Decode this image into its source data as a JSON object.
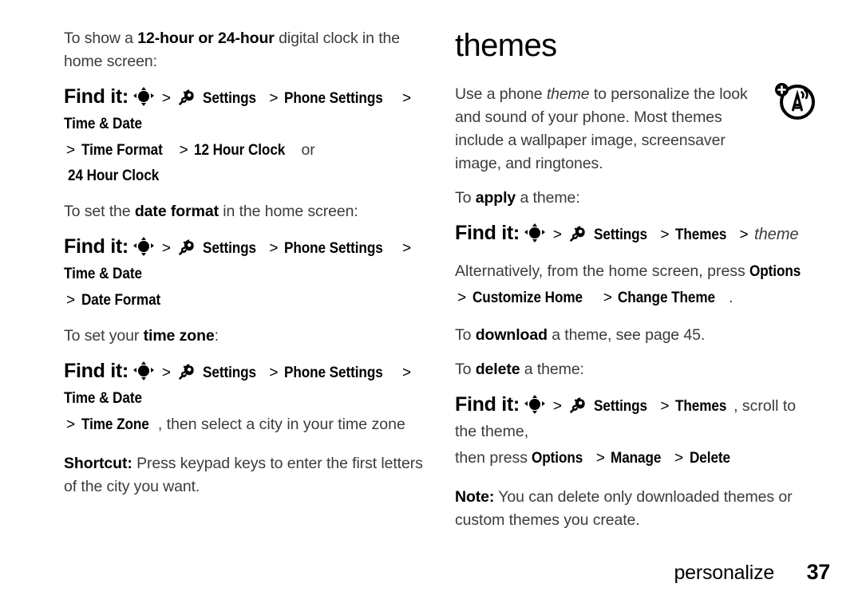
{
  "document": {
    "chapter": "personalize",
    "page_number": "37"
  },
  "left_column": {
    "intro_clock": {
      "prefix": "To show a ",
      "bold": "12-hour or 24-hour",
      "suffix": " digital clock in the home screen:"
    },
    "findit_clock": {
      "label": "Find it:",
      "nav_icon": "navigation-key-icon",
      "settings_icon": "settings-gear-wrench-icon",
      "settings": "Settings",
      "phone_settings": "Phone Settings",
      "time_date": "Time & Date",
      "time_format": "Time Format",
      "clock_12": "12 Hour Clock",
      "or_word": "or",
      "clock_24": "24 Hour Clock",
      "sep": ">"
    },
    "intro_dateformat": {
      "prefix": "To set the ",
      "bold": "date format",
      "suffix": " in the home screen:"
    },
    "findit_dateformat": {
      "label": "Find it:",
      "settings": "Settings",
      "phone_settings": "Phone Settings",
      "time_date": "Time & Date",
      "date_format": "Date Format",
      "sep": ">"
    },
    "intro_timezone": {
      "prefix": "To set your ",
      "bold": "time zone",
      "suffix": ":"
    },
    "findit_timezone": {
      "label": "Find it:",
      "settings": "Settings",
      "phone_settings": "Phone Settings",
      "time_date": "Time & Date",
      "time_zone": "Time Zone",
      "trailing": ", then select a city in your time zone",
      "sep": ">"
    },
    "shortcut": {
      "bold": "Shortcut:",
      "text": " Press keypad keys to enter the first letters of the city you want."
    }
  },
  "right_column": {
    "heading": "themes",
    "corner_icon": "antenna-tower-plus-icon",
    "intro": {
      "part1": "Use a phone ",
      "italic": "theme",
      "part2": " to personalize the look and sound of your phone. Most themes include a wallpaper image, screensaver image, and ringtones."
    },
    "apply_intro": {
      "prefix": "To ",
      "bold": "apply",
      "suffix": " a theme:"
    },
    "findit_apply": {
      "label": "Find it:",
      "settings": "Settings",
      "themes": "Themes",
      "theme_italic": "theme",
      "sep": ">"
    },
    "alternatively": {
      "text": "Alternatively, from the home screen, press ",
      "options": "Options",
      "customize_home": "Customize Home",
      "change_theme": "Change Theme",
      "period": ".",
      "sep": ">"
    },
    "download_note": {
      "prefix": "To ",
      "bold": "download",
      "suffix": " a theme, see page 45."
    },
    "delete_intro": {
      "prefix": "To ",
      "bold": "delete",
      "suffix": " a theme:"
    },
    "findit_delete": {
      "label": "Find it:",
      "settings": "Settings",
      "themes": "Themes",
      "scroll_text": ", scroll to the theme,",
      "then_press": "then press ",
      "options": "Options",
      "manage": "Manage",
      "delete": "Delete",
      "sep": ">"
    },
    "note": {
      "bold": "Note:",
      "text": " You can delete only downloaded themes or custom themes you create."
    }
  },
  "colors": {
    "body_text": "#3b3b3b",
    "emphasis": "#000000",
    "background": "#ffffff"
  }
}
